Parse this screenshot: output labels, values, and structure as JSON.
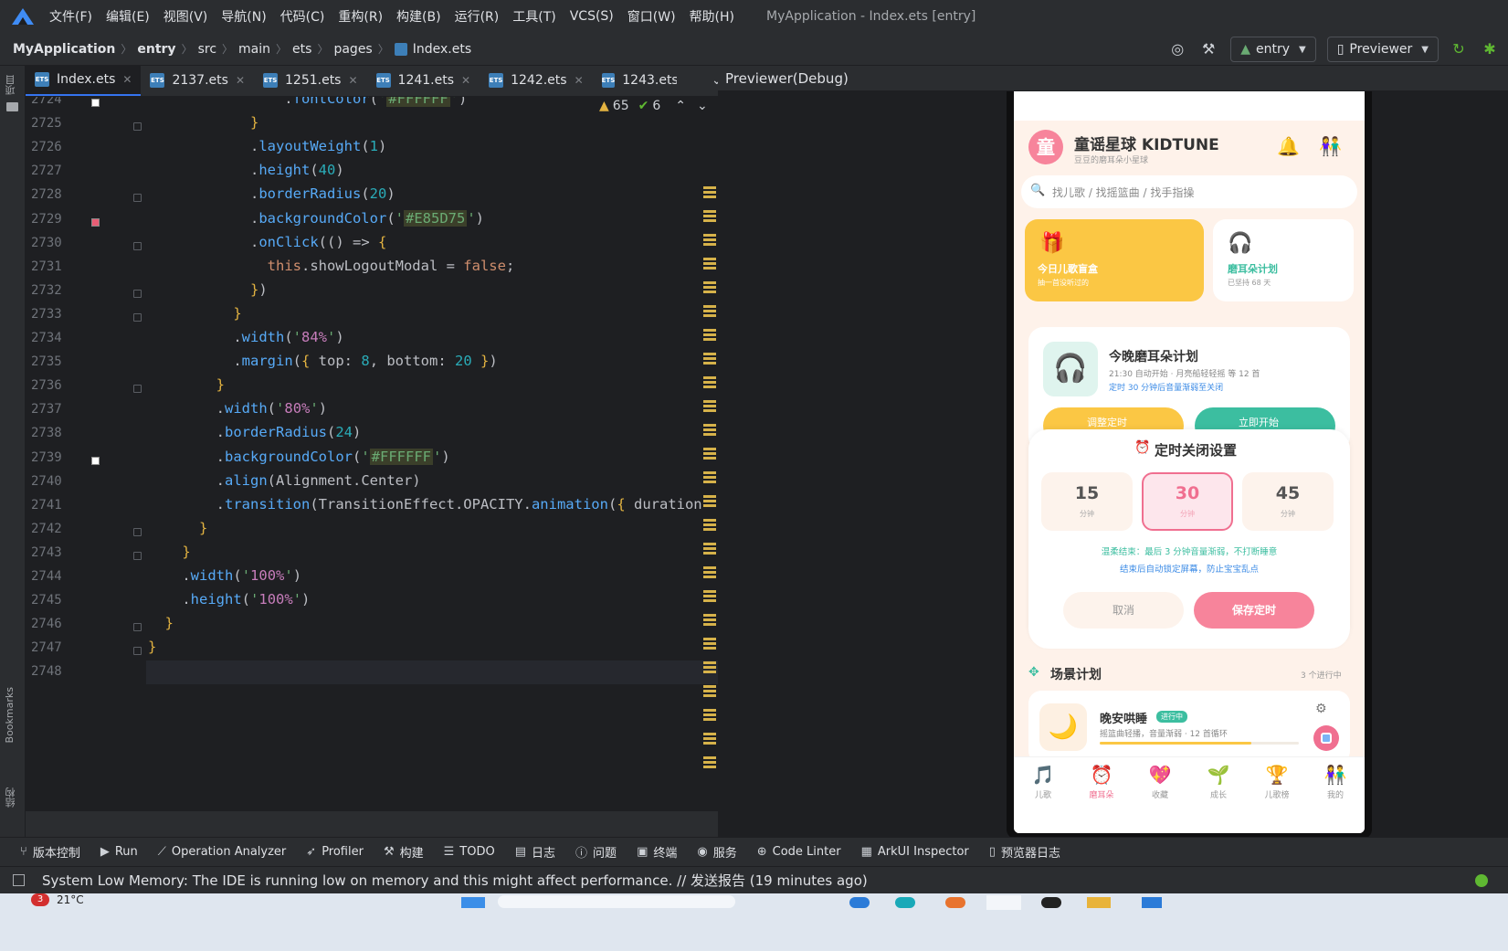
{
  "menu": [
    "文件(F)",
    "编辑(E)",
    "视图(V)",
    "导航(N)",
    "代码(C)",
    "重构(R)",
    "构建(B)",
    "运行(R)",
    "工具(T)",
    "VCS(S)",
    "窗口(W)",
    "帮助(H)"
  ],
  "window_title": "MyApplication - Index.ets [entry]",
  "breadcrumb": [
    "MyApplication",
    "entry",
    "src",
    "main",
    "ets",
    "pages",
    "Index.ets"
  ],
  "nav": {
    "module": "entry",
    "device": "Previewer"
  },
  "rail": {
    "project": "项目",
    "bookmarks": "Bookmarks",
    "structure": "结构"
  },
  "tabs": [
    {
      "label": "Index.ets",
      "active": true
    },
    {
      "label": "2137.ets"
    },
    {
      "label": "1251.ets"
    },
    {
      "label": "1241.ets"
    },
    {
      "label": "1242.ets"
    },
    {
      "label": "1243.ets"
    }
  ],
  "file_icon_text": "ETS",
  "editor": {
    "warnings": "65",
    "checks": "6",
    "lines": [
      {
        "n": "2724",
        "code": "                .fontColor('#FFFFFF')"
      },
      {
        "n": "2725",
        "code": "            }"
      },
      {
        "n": "2726",
        "code": "            .layoutWeight(1)"
      },
      {
        "n": "2727",
        "code": "            .height(40)"
      },
      {
        "n": "2728",
        "code": "            .borderRadius(20)"
      },
      {
        "n": "2729",
        "code": "            .backgroundColor('#E85D75')"
      },
      {
        "n": "2730",
        "code": "            .onClick(() => {"
      },
      {
        "n": "2731",
        "code": "              this.showLogoutModal = false;"
      },
      {
        "n": "2732",
        "code": "            })"
      },
      {
        "n": "2733",
        "code": "          }"
      },
      {
        "n": "2734",
        "code": "          .width('84%')"
      },
      {
        "n": "2735",
        "code": "          .margin({ top: 8, bottom: 20 })"
      },
      {
        "n": "2736",
        "code": "        }"
      },
      {
        "n": "2737",
        "code": "        .width('80%')"
      },
      {
        "n": "2738",
        "code": "        .borderRadius(24)"
      },
      {
        "n": "2739",
        "code": "        .backgroundColor('#FFFFFF')"
      },
      {
        "n": "2740",
        "code": "        .align(Alignment.Center)"
      },
      {
        "n": "2741",
        "code": "        .transition(TransitionEffect.OPACITY.animation({ duration"
      },
      {
        "n": "2742",
        "code": "      }"
      },
      {
        "n": "2743",
        "code": "    }"
      },
      {
        "n": "2744",
        "code": "    .width('100%')"
      },
      {
        "n": "2745",
        "code": "    .height('100%')"
      },
      {
        "n": "2746",
        "code": "  }"
      },
      {
        "n": "2747",
        "code": "}"
      },
      {
        "n": "2748",
        "code": ""
      }
    ]
  },
  "previewer_title": "Previewer(Debug)",
  "app": {
    "avatar": "童",
    "title": "童谣星球 KIDTUNE",
    "subtitle": "豆豆的磨耳朵小星球",
    "search_placeholder": "找儿歌 / 找摇篮曲 / 找手指操",
    "card1_title": "今日儿歌盲盒",
    "card1_sub": "抽一首没听过的",
    "card2_title": "磨耳朵计划",
    "card2_sub": "已坚持 68 天",
    "plan_title": "今晚磨耳朵计划",
    "plan_line1": "21:30 自动开始 · 月亮船轻轻摇 等 12 首",
    "plan_line2": "定时 30 分钟后音量渐弱至关闭",
    "btn_adjust": "调整定时",
    "btn_start": "立即开始",
    "modal_title": "定时关闭设置",
    "options": [
      {
        "value": "15",
        "unit": "分钟"
      },
      {
        "value": "30",
        "unit": "分钟",
        "selected": true
      },
      {
        "value": "45",
        "unit": "分钟"
      }
    ],
    "note1": "温柔结束：最后 3 分钟音量渐弱，不打断睡意",
    "note2": "结束后自动锁定屏幕，防止宝宝乱点",
    "cancel": "取消",
    "save": "保存定时",
    "scene_title": "场景计划",
    "scene_count": "3 个进行中",
    "scene_name": "晚安哄睡",
    "scene_badge": "进行中",
    "scene_desc": "摇篮曲轻播，音量渐弱 · 12 首循环",
    "nav": [
      "儿歌",
      "磨耳朵",
      "收藏",
      "成长",
      "儿歌榜",
      "我的"
    ],
    "nav_icons": [
      "🎵",
      "⏰",
      "💖",
      "🌱",
      "🏆",
      "👫"
    ],
    "accent": "#f06f90",
    "teal": "#3cbea0"
  },
  "tools": [
    "版本控制",
    "Run",
    "Operation Analyzer",
    "Profiler",
    "构建",
    "TODO",
    "日志",
    "问题",
    "终端",
    "服务",
    "Code Linter",
    "ArkUI Inspector",
    "预览器日志"
  ],
  "status": "System Low Memory: The IDE is running low on memory and this might affect performance. // 发送报告 (19 minutes ago)",
  "taskbar": {
    "weather": "21°C",
    "badge": "3"
  }
}
